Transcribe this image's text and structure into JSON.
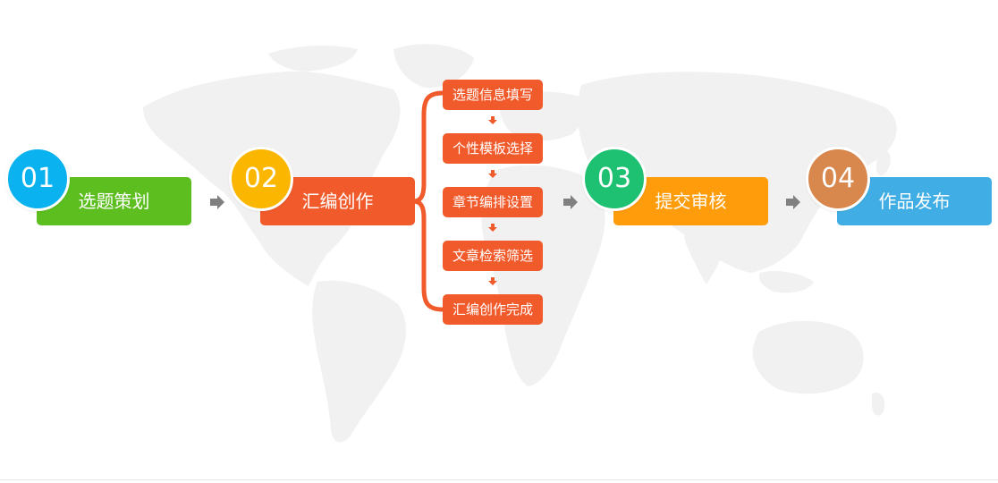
{
  "steps": [
    {
      "number": "01",
      "label": "选题策划",
      "color": "#5cbe1f",
      "circle_color": "#0ab2ef"
    },
    {
      "number": "02",
      "label": "汇编创作",
      "color": "#f15a2b",
      "circle_color": "#fbb700"
    },
    {
      "number": "03",
      "label": "提交审核",
      "color": "#fe9c0b",
      "circle_color": "#1dc171"
    },
    {
      "number": "04",
      "label": "作品发布",
      "color": "#40aee5",
      "circle_color": "#d8874d"
    }
  ],
  "sub_steps": [
    "选题信息填写",
    "个性模板选择",
    "章节编排设置",
    "文章检索筛选",
    "汇编创作完成"
  ],
  "colors": {
    "map": "#f0f0f0",
    "connector_arrow": "#808080",
    "sub_arrow": "#f15a2b"
  }
}
